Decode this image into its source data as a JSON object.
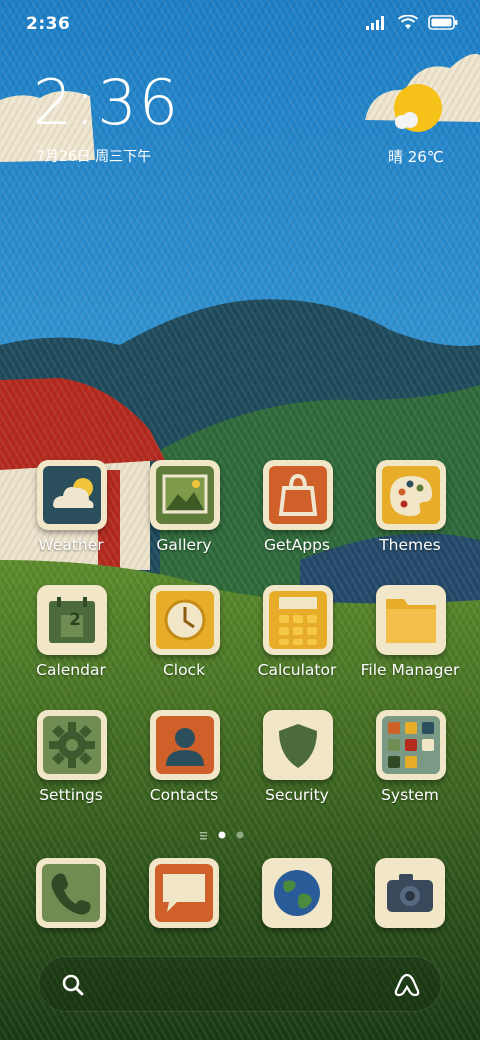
{
  "status_bar": {
    "time": "2:36"
  },
  "widget": {
    "time": "2:36",
    "date": "7月26日 周三下午",
    "weather": "晴 26℃"
  },
  "apps": [
    {
      "label": "Weather",
      "icon": "weather-icon"
    },
    {
      "label": "Gallery",
      "icon": "gallery-icon"
    },
    {
      "label": "GetApps",
      "icon": "getapps-icon"
    },
    {
      "label": "Themes",
      "icon": "themes-icon"
    },
    {
      "label": "Calendar",
      "icon": "calendar-icon",
      "badge_text": "2"
    },
    {
      "label": "Clock",
      "icon": "clock-icon"
    },
    {
      "label": "Calculator",
      "icon": "calculator-icon"
    },
    {
      "label": "File Manager",
      "icon": "folder-icon"
    },
    {
      "label": "Settings",
      "icon": "gear-icon"
    },
    {
      "label": "Contacts",
      "icon": "person-icon"
    },
    {
      "label": "Security",
      "icon": "shield-icon"
    },
    {
      "label": "System",
      "icon": "system-folder-icon"
    }
  ],
  "dock": [
    {
      "icon": "phone-icon"
    },
    {
      "icon": "messages-icon"
    },
    {
      "icon": "browser-globe-icon"
    },
    {
      "icon": "camera-icon"
    }
  ],
  "page_indicator": {
    "pages": 2,
    "current": 1
  },
  "colors": {
    "sky": "#2f95d6",
    "hills_dark": "#1f4f5f",
    "grass": "#3f7a22",
    "icon_frame": "#f1e6c8"
  }
}
